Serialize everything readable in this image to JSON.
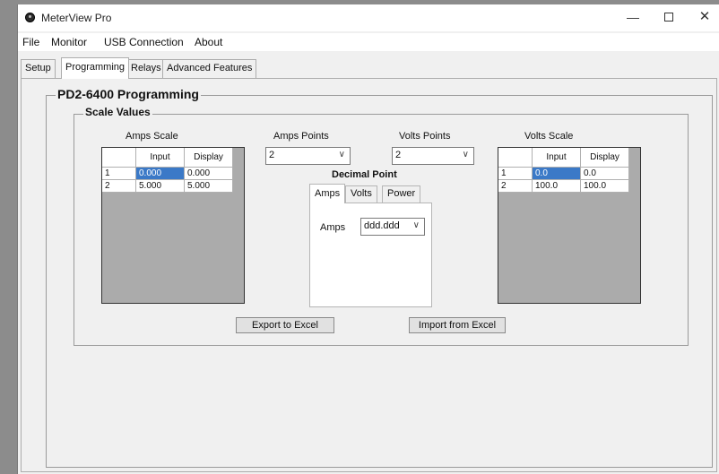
{
  "window": {
    "title": "MeterView Pro",
    "controls": {
      "minimize": "—",
      "close": "✕"
    }
  },
  "menu": [
    "File",
    "Monitor",
    "USB Connection",
    "About"
  ],
  "tabs": [
    "Setup",
    "Programming",
    "Relays",
    "Advanced Features"
  ],
  "active_tab": "Programming",
  "programming": {
    "title": "PD2-6400 Programming",
    "scale_values": {
      "title": "Scale Values",
      "amps_scale": {
        "label": "Amps Scale",
        "columns": [
          "Input",
          "Display"
        ],
        "rows": [
          {
            "index": "1",
            "input": "0.000",
            "display": "0.000"
          },
          {
            "index": "2",
            "input": "5.000",
            "display": "5.000"
          }
        ]
      },
      "amps_points": {
        "label": "Amps Points",
        "value": "2"
      },
      "volts_points": {
        "label": "Volts Points",
        "value": "2"
      },
      "volts_scale": {
        "label": "Volts Scale",
        "columns": [
          "Input",
          "Display"
        ],
        "rows": [
          {
            "index": "1",
            "input": "0.0",
            "display": "0.0"
          },
          {
            "index": "2",
            "input": "100.0",
            "display": "100.0"
          }
        ]
      },
      "decimal_point": {
        "title": "Decimal Point",
        "tabs": [
          "Amps",
          "Volts",
          "Power"
        ],
        "active_tab": "Amps",
        "field_label": "Amps",
        "field_value": "ddd.ddd"
      },
      "export_button": "Export to Excel",
      "import_button": "Import from Excel"
    }
  },
  "colors": {
    "selection": "#3b79c7",
    "grid_background": "#ababab",
    "window_background": "#f0f0f0"
  }
}
